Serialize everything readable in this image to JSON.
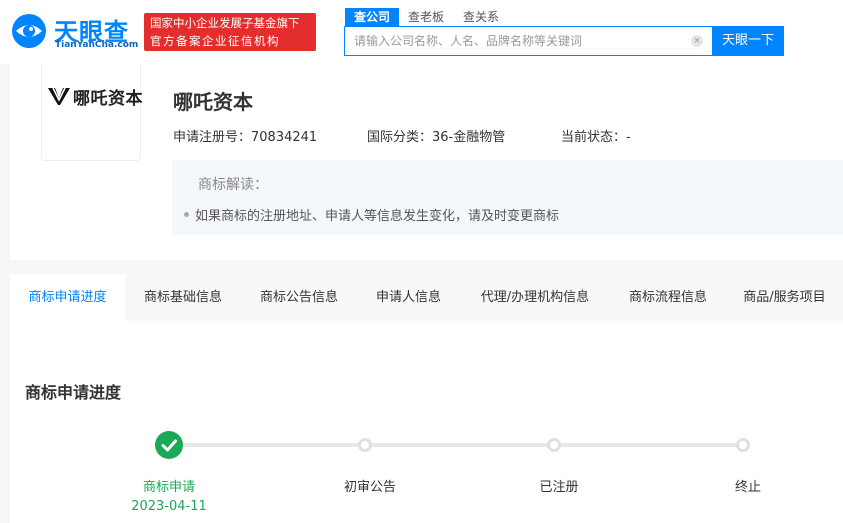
{
  "header": {
    "logo_text": "天眼查",
    "logo_sub": "TianYanCha.com",
    "badge_line1": "国家中小企业发展子基金旗下",
    "badge_line2": "官方备案企业征信机构",
    "search_tabs": [
      "查公司",
      "查老板",
      "查关系"
    ],
    "search_placeholder": "请输入公司名称、人名、品牌名称等关键词",
    "search_button": "天眼一下",
    "clear_icon": "×"
  },
  "trademark": {
    "logo_text": "哪吒资本",
    "name": "哪吒资本",
    "reg_no": "申请注册号：70834241",
    "intl_class": "国际分类：36-金融物管",
    "status": "当前状态：-",
    "interp_title": "商标解读：",
    "interp_item": "如果商标的注册地址、申请人等信息发生变化，请及时变更商标"
  },
  "tabs": [
    "商标申请进度",
    "商标基础信息",
    "商标公告信息",
    "申请人信息",
    "代理/办理机构信息",
    "商标流程信息",
    "商品/服务项目"
  ],
  "progress": {
    "title": "商标申请进度",
    "steps": [
      {
        "label": "商标申请",
        "date": "2023-04-11",
        "done": true
      },
      {
        "label": "初审公告",
        "date": "",
        "done": false
      },
      {
        "label": "已注册",
        "date": "",
        "done": false
      },
      {
        "label": "终止",
        "date": "",
        "done": false
      }
    ]
  },
  "colors": {
    "accent": "#0084ff",
    "success": "#1aaa55",
    "badge": "#e42d2d"
  }
}
